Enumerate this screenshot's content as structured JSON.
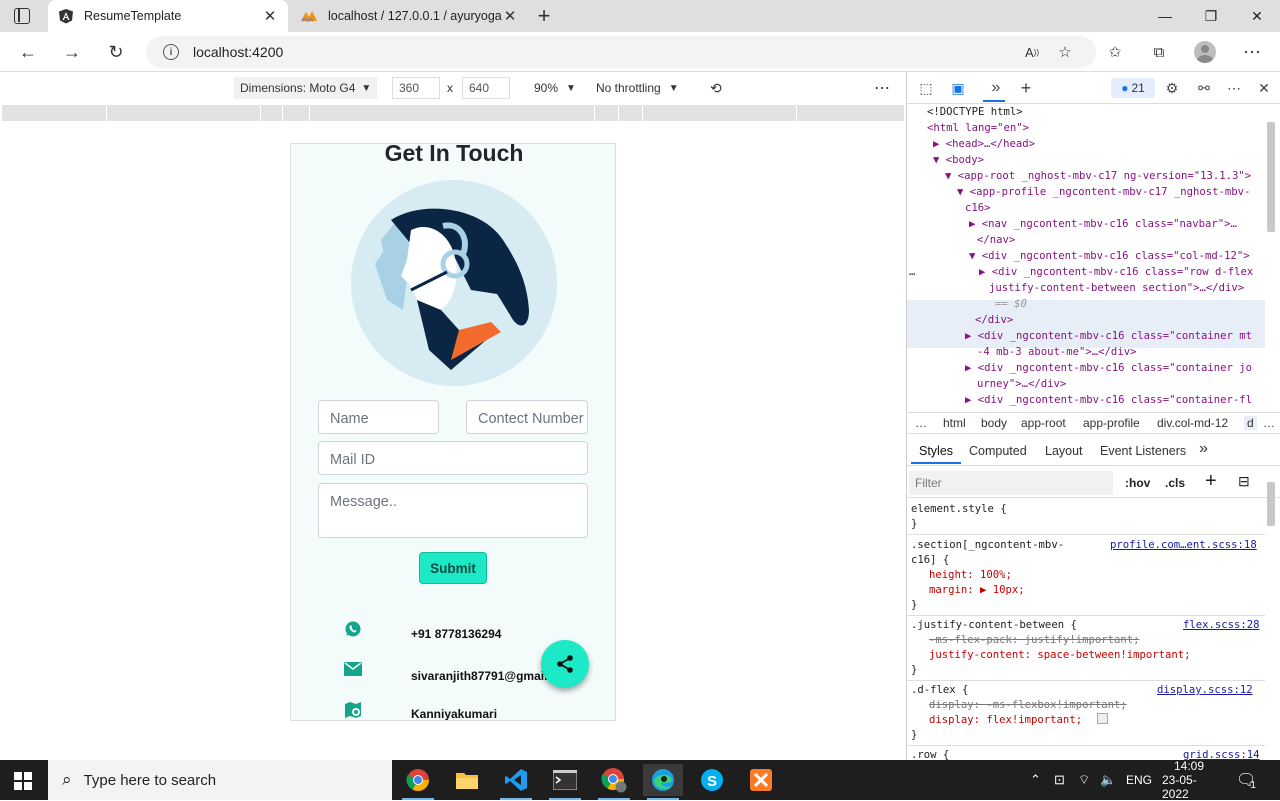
{
  "browser": {
    "tabs": [
      {
        "title": "ResumeTemplate",
        "icon": "angular-icon",
        "active": true
      },
      {
        "title": "localhost / 127.0.0.1 / ayuryogam",
        "icon": "phpmyadmin-icon",
        "active": false
      }
    ],
    "url": "localhost:4200"
  },
  "device_toolbar": {
    "device": "Dimensions: Moto G4",
    "width": "360",
    "height": "640",
    "times": "x",
    "zoom": "90%",
    "throttling": "No throttling"
  },
  "page": {
    "heading": "Get In Touch",
    "form": {
      "name_placeholder": "Name",
      "contact_placeholder": "Contect Number",
      "mail_placeholder": "Mail ID",
      "message_placeholder": "Message..",
      "submit_label": "Submit"
    },
    "contacts": [
      {
        "icon": "whatsapp-icon",
        "text": "+91 8778136294"
      },
      {
        "icon": "mail-icon",
        "text": "sivaranjith87791@gmail.com"
      },
      {
        "icon": "location-icon",
        "text": "Kanniyakumari"
      }
    ]
  },
  "devtools": {
    "badge_count": "21",
    "dom_lines": [
      "<!DOCTYPE html>",
      "<html lang=\"en\">",
      "<head>…</head>",
      "<body>",
      "<app-root _nghost-mbv-c17 ng-version=\"13.1.3\">",
      "<app-profile _ngcontent-mbv-c17 _nghost-mbv-",
      "c16>",
      "<nav _ngcontent-mbv-c16 class=\"navbar\">…",
      "</nav>",
      "<div _ngcontent-mbv-c16 class=\"col-md-12\">",
      "<div _ngcontent-mbv-c16 class=\"row d-flex",
      "justify-content-between section\">…</div>",
      "== $0",
      "</div>",
      "<div _ngcontent-mbv-c16 class=\"container mt",
      "-4 mb-3 about-me\">…</div>",
      "<div _ngcontent-mbv-c16 class=\"container jo",
      "urney\">…</div>",
      "<div _ngcontent-mbv-c16 class=\"container-fl"
    ],
    "selected_dots": "…",
    "breadcrumbs": [
      "…",
      "html",
      "body",
      "app-root",
      "app-profile",
      "div.col-md-12",
      "d",
      "…"
    ],
    "style_tabs": [
      "Styles",
      "Computed",
      "Layout",
      "Event Listeners"
    ],
    "filter_placeholder": "Filter",
    "hov": ":hov",
    "cls": ".cls",
    "styles": [
      {
        "selector": "element.style {",
        "close": "}"
      },
      {
        "selector": ".section[_ngcontent-mbv-",
        "selector2": "c16] {",
        "source": "profile.com…ent.scss:18",
        "props": [
          "height: 100%;",
          "margin: ▶ 10px;"
        ],
        "close": "}"
      },
      {
        "selector": ".justify-content-between {",
        "source": "flex.scss:28",
        "props": [
          "-ms-flex-pack: justify!important;",
          "justify-content: space-between!important;"
        ],
        "close": "}"
      },
      {
        "selector": ".d-flex {",
        "source": "display.scss:12",
        "props": [
          "display: -ms-flexbox!important;",
          "display: flex!important;"
        ],
        "close": "}"
      },
      {
        "selector": ".row {",
        "source": "grid.scss:14"
      }
    ]
  },
  "taskbar": {
    "search_placeholder": "Type here to search",
    "lang": "ENG",
    "time": "14:09",
    "date": "23-05-2022",
    "notification_count": "1"
  }
}
